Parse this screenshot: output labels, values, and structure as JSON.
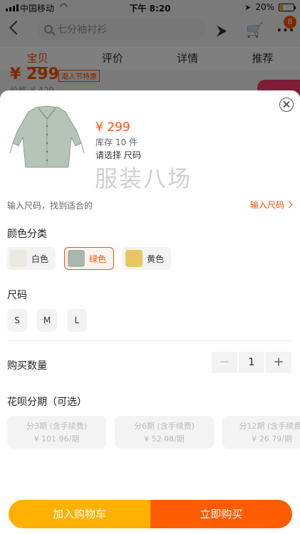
{
  "status_bar": {
    "carrier": "中国移动",
    "time": "下午 8:20",
    "battery": "20%"
  },
  "top_nav": {
    "search_placeholder": "七分袖衬衫",
    "cart_badge": "8"
  },
  "tabs": [
    "宝贝",
    "评价",
    "详情",
    "推荐"
  ],
  "background_product": {
    "price": "¥ 299",
    "tag": "潮人节特惠",
    "original_price": "价格 ¥ 429"
  },
  "sheet": {
    "price": "¥ 299",
    "stock": "库存 10 件",
    "select_hint": "请选择 尺码",
    "size_tip": "输入尺码，找到适合的",
    "size_link": "输入尺码",
    "color_title": "颜色分类",
    "colors": [
      {
        "label": "白色",
        "swatch": "#ece9e2",
        "selected": false
      },
      {
        "label": "绿色",
        "swatch": "#aab5ad",
        "selected": true
      },
      {
        "label": "黄色",
        "swatch": "#e8c85e",
        "selected": false
      }
    ],
    "size_title": "尺码",
    "sizes": [
      "S",
      "M",
      "L"
    ],
    "quantity_label": "购买数量",
    "quantity": "1",
    "installment_title": "花呗分期（可选）",
    "installments": [
      {
        "title": "分3期 (含手续费)",
        "price": "¥ 101.96/期"
      },
      {
        "title": "分6期 (含手续费)",
        "price": "¥ 52.08/期"
      },
      {
        "title": "分12期 (含手续费)",
        "price": "¥ 26.79/期"
      }
    ],
    "add_to_cart": "加入购物车",
    "buy_now": "立即购买"
  },
  "watermark": "服装八场",
  "colors": {
    "accent": "#ff5000",
    "cart_button": "#ffb000",
    "buy_button": "#ff5b00"
  }
}
